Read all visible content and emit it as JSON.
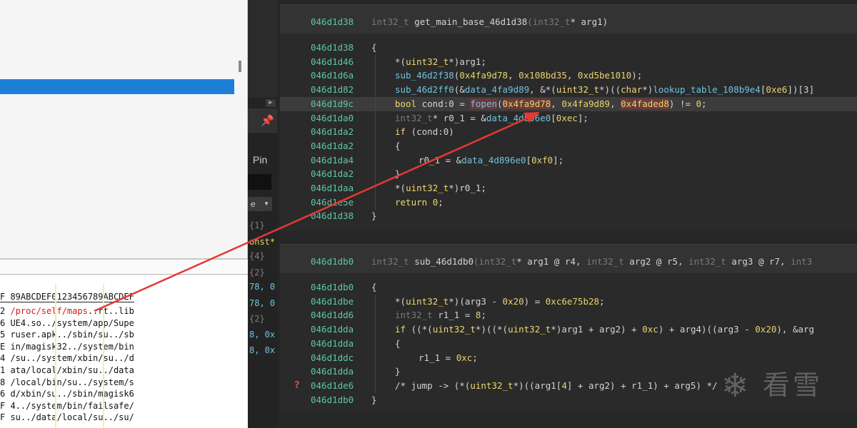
{
  "left_pane": {
    "hex_header": "F 89ABCDEF0123456789ABCDEF",
    "hex_rows": [
      {
        "prefix": "2 ",
        "red": "/proc/self/maps",
        "rest": "..rt..lib"
      },
      {
        "prefix": "6 ",
        "red": "",
        "rest": "UE4.so../system/app/Supe"
      },
      {
        "prefix": "5 ",
        "red": "",
        "rest": "ruser.apk../sbin/su../sb"
      },
      {
        "prefix": "E ",
        "red": "",
        "rest": "in/magisk32../system/bin"
      },
      {
        "prefix": "4 ",
        "red": "",
        "rest": "/su../system/xbin/su../d"
      },
      {
        "prefix": "1 ",
        "red": "",
        "rest": "ata/local/xbin/su../data"
      },
      {
        "prefix": "8 ",
        "red": "",
        "rest": "/local/bin/su../system/s"
      },
      {
        "prefix": "6 ",
        "red": "",
        "rest": "d/xbin/su../sbin/magisk6"
      },
      {
        "prefix": "F ",
        "red": "",
        "rest": "4../system/bin/failsafe/"
      },
      {
        "prefix": "F ",
        "red": "",
        "rest": "su../data/local/su../su/"
      }
    ]
  },
  "middle_pane": {
    "play_icon": "▶",
    "pin_icon": "📌",
    "pin_label": "Pin",
    "select_value": "e",
    "select_arrow": "▼",
    "lines": [
      {
        "text": "{1}",
        "color": "#7f7f7f"
      },
      {
        "text": "onst*",
        "color": "#e8d36a"
      },
      {
        "text": "{4}",
        "color": "#7f7f7f"
      },
      {
        "text": "{2}",
        "color": "#7f7f7f"
      },
      {
        "text": "78, 0",
        "color": "#6fc3df"
      },
      {
        "text": "78, 0",
        "color": "#6fc3df"
      },
      {
        "text": "{2}",
        "color": "#7f7f7f"
      },
      {
        "text": "8, 0x",
        "color": "#6fc3df"
      },
      {
        "text": "8, 0x",
        "color": "#6fc3df"
      }
    ]
  },
  "functions": [
    {
      "header": {
        "addr": "046d1d38",
        "signature": [
          {
            "t": "int32_t ",
            "c": "t-type"
          },
          {
            "t": "get_main_base_46d1d38",
            "c": "t-plain"
          },
          {
            "t": "(",
            "c": "t-type"
          },
          {
            "t": "int32_t",
            "c": "t-type"
          },
          {
            "t": "* arg1)",
            "c": "t-plain"
          }
        ]
      },
      "lines": [
        {
          "addr": "046d1d38",
          "indent": 0,
          "tokens": [
            {
              "t": "{",
              "c": "t-plain"
            }
          ]
        },
        {
          "addr": "046d1d46",
          "indent": 1,
          "tokens": [
            {
              "t": "*(",
              "c": "t-plain"
            },
            {
              "t": "uint32_t",
              "c": "t-kw"
            },
            {
              "t": "*)arg1;",
              "c": "t-plain"
            }
          ]
        },
        {
          "addr": "046d1d6a",
          "indent": 1,
          "tokens": [
            {
              "t": "sub_46d2f38",
              "c": "t-fn"
            },
            {
              "t": "(",
              "c": "t-plain"
            },
            {
              "t": "0x4fa9d78",
              "c": "t-num"
            },
            {
              "t": ", ",
              "c": "t-plain"
            },
            {
              "t": "0x108bd35",
              "c": "t-num"
            },
            {
              "t": ", ",
              "c": "t-plain"
            },
            {
              "t": "0xd5be1010",
              "c": "t-num"
            },
            {
              "t": ");",
              "c": "t-plain"
            }
          ]
        },
        {
          "addr": "046d1d82",
          "indent": 1,
          "tokens": [
            {
              "t": "sub_46d2ff0",
              "c": "t-fn"
            },
            {
              "t": "(&",
              "c": "t-plain"
            },
            {
              "t": "data_4fa9d89",
              "c": "t-data"
            },
            {
              "t": ", &*(",
              "c": "t-plain"
            },
            {
              "t": "uint32_t",
              "c": "t-kw"
            },
            {
              "t": "*)((",
              "c": "t-plain"
            },
            {
              "t": "char",
              "c": "t-kw"
            },
            {
              "t": "*)",
              "c": "t-plain"
            },
            {
              "t": "lookup_table_108b9e4",
              "c": "t-data"
            },
            {
              "t": "[",
              "c": "t-plain"
            },
            {
              "t": "0xe6",
              "c": "t-num"
            },
            {
              "t": "])[3]",
              "c": "t-plain"
            }
          ]
        },
        {
          "addr": "046d1d9c",
          "indent": 1,
          "highlight": true,
          "tokens": [
            {
              "t": "bool",
              "c": "t-kw"
            },
            {
              "t": " cond:0 = ",
              "c": "t-plain"
            },
            {
              "t": "fopen",
              "c": "t-fn",
              "hl": true
            },
            {
              "t": "(",
              "c": "t-plain"
            },
            {
              "t": "0x4fa9d78",
              "c": "t-num",
              "hl": true
            },
            {
              "t": ", ",
              "c": "t-plain"
            },
            {
              "t": "0x4fa9d89",
              "c": "t-num"
            },
            {
              "t": ", ",
              "c": "t-plain"
            },
            {
              "t": "0x4faded8",
              "c": "t-num",
              "hl": true
            },
            {
              "t": ") != ",
              "c": "t-plain"
            },
            {
              "t": "0",
              "c": "t-num"
            },
            {
              "t": ";",
              "c": "t-plain"
            }
          ]
        },
        {
          "addr": "046d1da0",
          "indent": 1,
          "tokens": [
            {
              "t": "int32_t",
              "c": "t-type"
            },
            {
              "t": "* r0_1 = &",
              "c": "t-plain"
            },
            {
              "t": "data_4d896e0",
              "c": "t-data"
            },
            {
              "t": "[",
              "c": "t-plain"
            },
            {
              "t": "0xec",
              "c": "t-num"
            },
            {
              "t": "];",
              "c": "t-plain"
            }
          ]
        },
        {
          "addr": "046d1da2",
          "indent": 1,
          "tokens": [
            {
              "t": "if",
              "c": "t-kw"
            },
            {
              "t": " (cond:0)",
              "c": "t-plain"
            }
          ]
        },
        {
          "addr": "046d1da2",
          "indent": 1,
          "tokens": [
            {
              "t": "{",
              "c": "t-plain"
            }
          ]
        },
        {
          "addr": "046d1da4",
          "indent": 2,
          "tokens": [
            {
              "t": "r0_1 = &",
              "c": "t-plain"
            },
            {
              "t": "data_4d896e0",
              "c": "t-data"
            },
            {
              "t": "[",
              "c": "t-plain"
            },
            {
              "t": "0xf0",
              "c": "t-num"
            },
            {
              "t": "];",
              "c": "t-plain"
            }
          ]
        },
        {
          "addr": "046d1da2",
          "indent": 1,
          "tokens": [
            {
              "t": "}",
              "c": "t-plain"
            }
          ]
        },
        {
          "addr": "046d1daa",
          "indent": 1,
          "tokens": [
            {
              "t": "*(",
              "c": "t-plain"
            },
            {
              "t": "uint32_t",
              "c": "t-kw"
            },
            {
              "t": "*)r0_1;",
              "c": "t-plain"
            }
          ]
        },
        {
          "addr": "046d1e5e",
          "indent": 1,
          "tokens": [
            {
              "t": "return",
              "c": "t-kw"
            },
            {
              "t": " ",
              "c": "t-plain"
            },
            {
              "t": "0",
              "c": "t-num"
            },
            {
              "t": ";",
              "c": "t-plain"
            }
          ]
        },
        {
          "addr": "046d1d38",
          "indent": 0,
          "tokens": [
            {
              "t": "}",
              "c": "t-plain"
            }
          ]
        }
      ]
    },
    {
      "header": {
        "addr": "046d1db0",
        "signature": [
          {
            "t": "int32_t ",
            "c": "t-type"
          },
          {
            "t": "sub_46d1db0",
            "c": "t-plain"
          },
          {
            "t": "(",
            "c": "t-type"
          },
          {
            "t": "int32_t",
            "c": "t-type"
          },
          {
            "t": "* arg1 @ r4, ",
            "c": "t-plain"
          },
          {
            "t": "int32_t ",
            "c": "t-type"
          },
          {
            "t": "arg2 @ r5, ",
            "c": "t-plain"
          },
          {
            "t": "int32_t ",
            "c": "t-type"
          },
          {
            "t": "arg3 @ r7, ",
            "c": "t-plain"
          },
          {
            "t": "int3",
            "c": "t-type"
          }
        ]
      },
      "lines": [
        {
          "addr": "046d1db0",
          "indent": 0,
          "tokens": [
            {
              "t": "{",
              "c": "t-plain"
            }
          ]
        },
        {
          "addr": "046d1dbe",
          "indent": 1,
          "tokens": [
            {
              "t": "*(",
              "c": "t-plain"
            },
            {
              "t": "uint32_t",
              "c": "t-kw"
            },
            {
              "t": "*)(arg3 - ",
              "c": "t-plain"
            },
            {
              "t": "0x20",
              "c": "t-num"
            },
            {
              "t": ") = ",
              "c": "t-plain"
            },
            {
              "t": "0xc6e75b28",
              "c": "t-num"
            },
            {
              "t": ";",
              "c": "t-plain"
            }
          ]
        },
        {
          "addr": "046d1dd6",
          "indent": 1,
          "tokens": [
            {
              "t": "int32_t",
              "c": "t-type"
            },
            {
              "t": " r1_1 = ",
              "c": "t-plain"
            },
            {
              "t": "8",
              "c": "t-num"
            },
            {
              "t": ";",
              "c": "t-plain"
            }
          ]
        },
        {
          "addr": "046d1dda",
          "indent": 1,
          "tokens": [
            {
              "t": "if",
              "c": "t-kw"
            },
            {
              "t": " ((*(",
              "c": "t-plain"
            },
            {
              "t": "uint32_t",
              "c": "t-kw"
            },
            {
              "t": "*)((*(",
              "c": "t-plain"
            },
            {
              "t": "uint32_t",
              "c": "t-kw"
            },
            {
              "t": "*)arg1 + arg2) + ",
              "c": "t-plain"
            },
            {
              "t": "0xc",
              "c": "t-num"
            },
            {
              "t": ") + arg4)((arg3 - ",
              "c": "t-plain"
            },
            {
              "t": "0x20",
              "c": "t-num"
            },
            {
              "t": "), &arg",
              "c": "t-plain"
            }
          ]
        },
        {
          "addr": "046d1dda",
          "indent": 1,
          "tokens": [
            {
              "t": "{",
              "c": "t-plain"
            }
          ]
        },
        {
          "addr": "046d1ddc",
          "indent": 2,
          "tokens": [
            {
              "t": "r1_1 = ",
              "c": "t-plain"
            },
            {
              "t": "0xc",
              "c": "t-num"
            },
            {
              "t": ";",
              "c": "t-plain"
            }
          ]
        },
        {
          "addr": "046d1dda",
          "indent": 1,
          "tokens": [
            {
              "t": "}",
              "c": "t-plain"
            }
          ]
        },
        {
          "addr": "046d1de6",
          "indent": 1,
          "mark": "?",
          "tokens": [
            {
              "t": "/* jump -> (*(",
              "c": "t-comment"
            },
            {
              "t": "uint32_t",
              "c": "t-kw"
            },
            {
              "t": "*)((arg1[",
              "c": "t-comment"
            },
            {
              "t": "4",
              "c": "t-num"
            },
            {
              "t": "] + arg2) + r1_1) + arg5) */",
              "c": "t-comment"
            }
          ]
        },
        {
          "addr": "046d1db0",
          "indent": 0,
          "tokens": [
            {
              "t": "}",
              "c": "t-plain"
            }
          ]
        }
      ]
    }
  ],
  "watermark": {
    "snowflake": "❄",
    "text": "看雪"
  },
  "colors": {
    "arrow": "#e53935",
    "selection": "#1e7fd8",
    "address": "#5cc8a3"
  }
}
